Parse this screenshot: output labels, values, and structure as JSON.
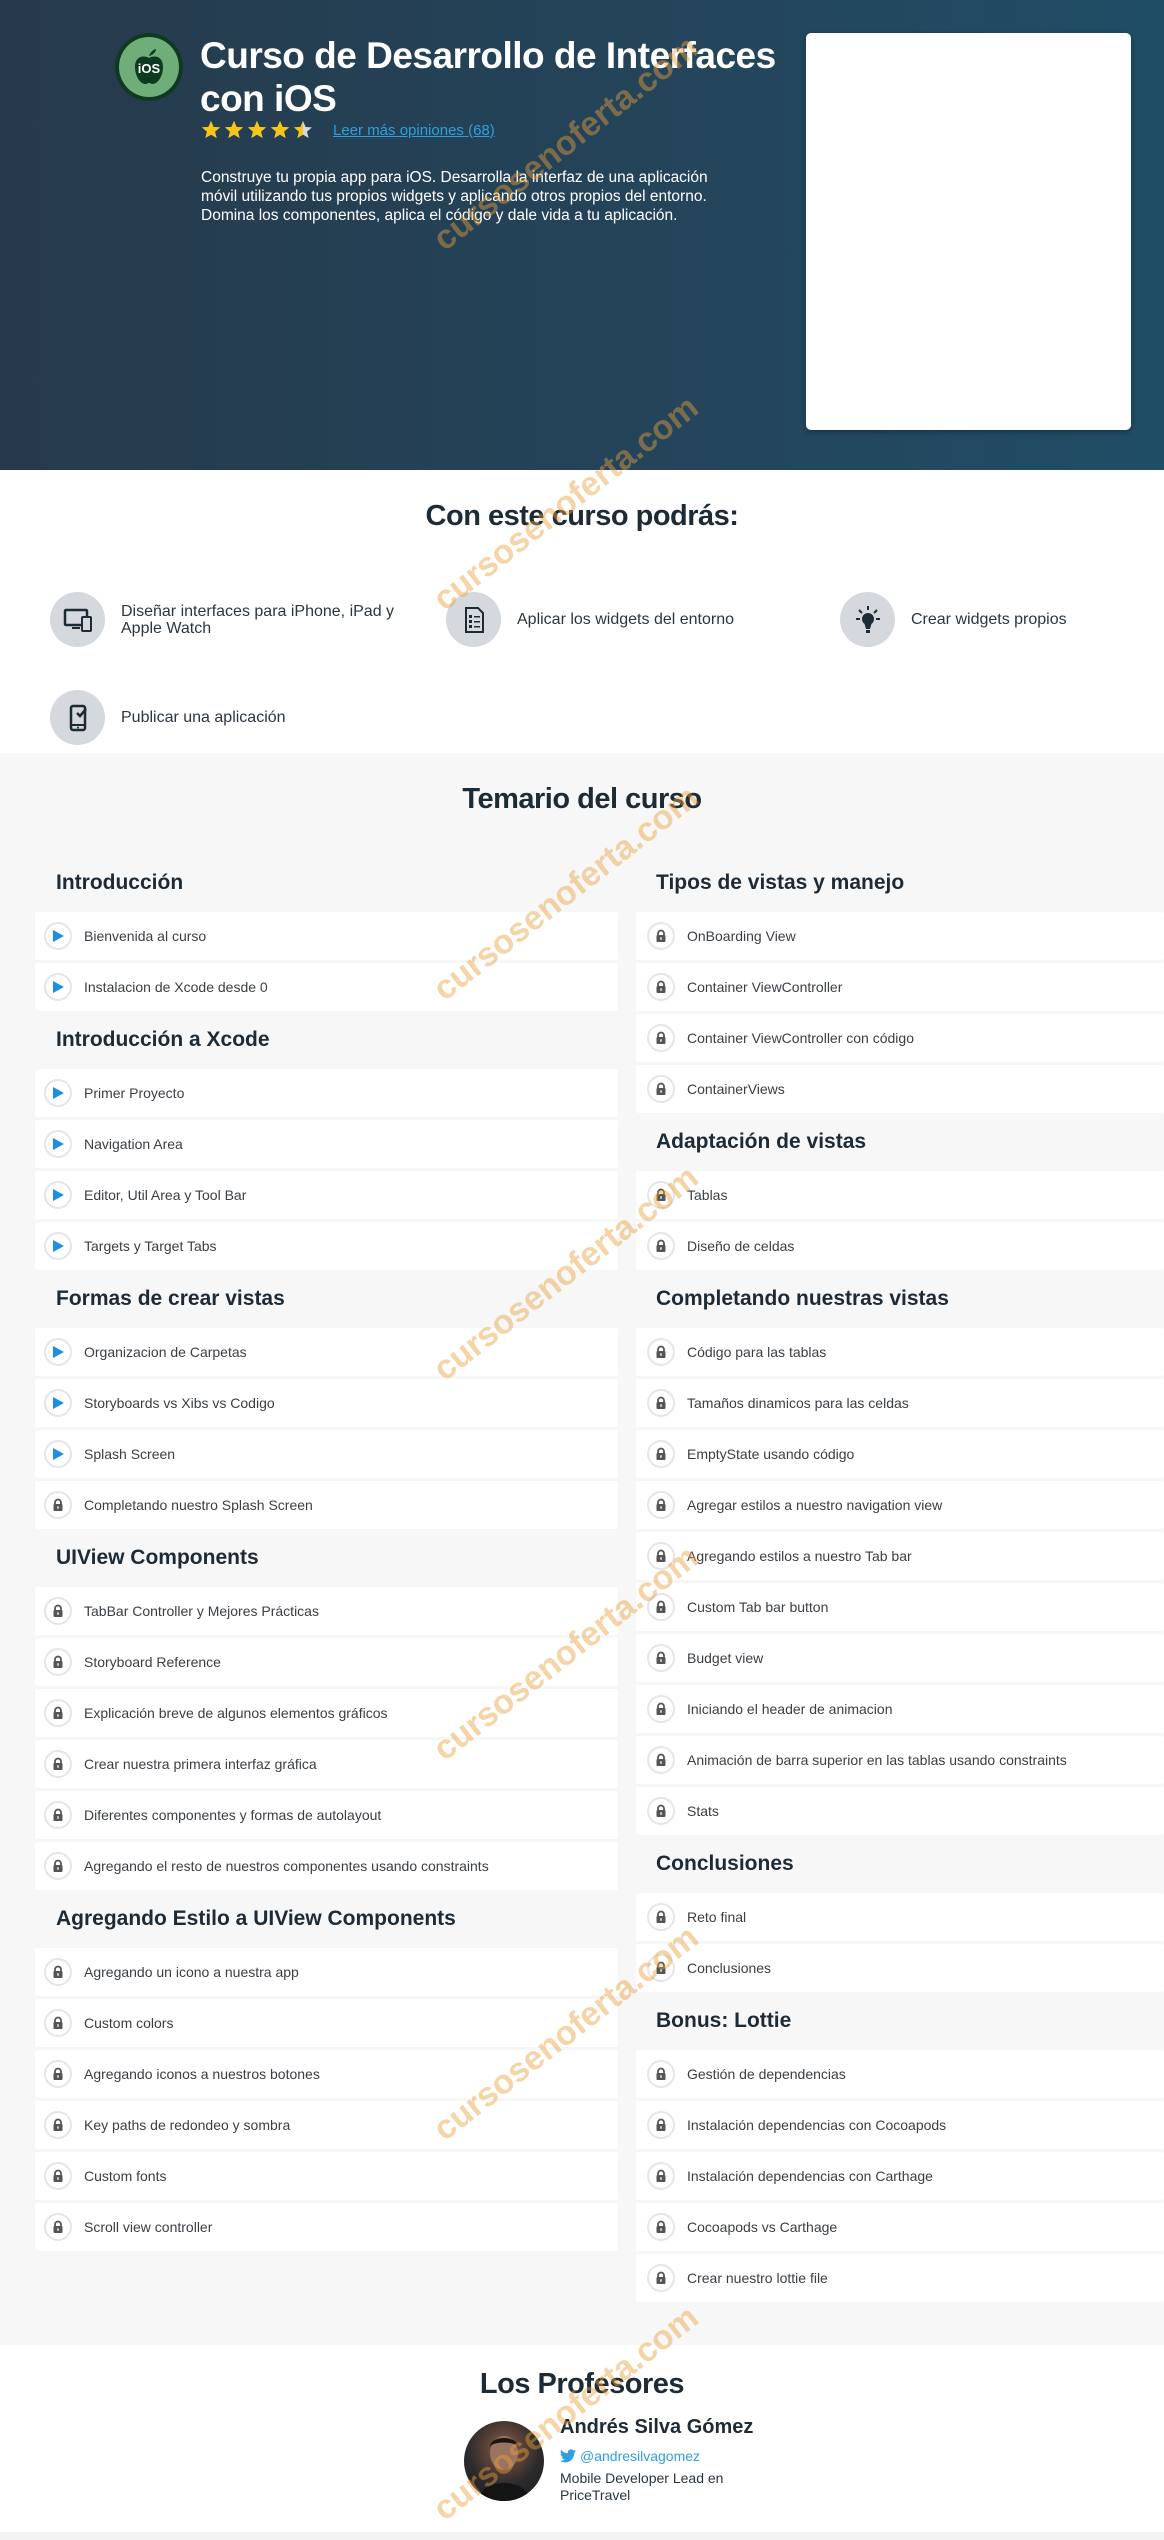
{
  "hero": {
    "logo_text": "iOS",
    "title": "Curso de Desarrollo de Interfaces con iOS",
    "rating": 4.5,
    "rating_max": 5,
    "reviews_link": "Leer más opiniones (68)",
    "description": "Construye tu propia app para iOS. Desarrolla la interfaz de una aplicación móvil utilizando tus propios widgets y aplicando otros propios del entorno. Domina los componentes, aplica el código y dale vida a tu aplicación."
  },
  "benefits": {
    "title": "Con este curso podrás:",
    "items": [
      {
        "icon": "devices-icon",
        "label": "Diseñar interfaces para iPhone, iPad y Apple Watch"
      },
      {
        "icon": "checklist-icon",
        "label": "Aplicar los widgets del entorno"
      },
      {
        "icon": "lightbulb-icon",
        "label": "Crear widgets propios"
      },
      {
        "icon": "phone-check-icon",
        "label": "Publicar una aplicación"
      }
    ]
  },
  "syllabus": {
    "title": "Temario del curso",
    "left": [
      {
        "title": "Introducción",
        "lessons": [
          {
            "label": "Bienvenida al curso",
            "status": "play"
          },
          {
            "label": "Instalacion de Xcode desde 0",
            "status": "play"
          }
        ]
      },
      {
        "title": "Introducción a Xcode",
        "lessons": [
          {
            "label": "Primer Proyecto",
            "status": "play"
          },
          {
            "label": "Navigation Area",
            "status": "play"
          },
          {
            "label": "Editor, Util Area y Tool Bar",
            "status": "play"
          },
          {
            "label": "Targets y Target Tabs",
            "status": "play"
          }
        ]
      },
      {
        "title": "Formas de crear vistas",
        "lessons": [
          {
            "label": "Organizacion de Carpetas",
            "status": "play"
          },
          {
            "label": "Storyboards vs Xibs vs Codigo",
            "status": "play"
          },
          {
            "label": "Splash Screen",
            "status": "play"
          },
          {
            "label": "Completando nuestro Splash Screen",
            "status": "locked"
          }
        ]
      },
      {
        "title": "UIView Components",
        "lessons": [
          {
            "label": "TabBar Controller y Mejores Prácticas",
            "status": "locked"
          },
          {
            "label": "Storyboard Reference",
            "status": "locked"
          },
          {
            "label": "Explicación breve de algunos elementos gráficos",
            "status": "locked"
          },
          {
            "label": "Crear nuestra primera interfaz gráfica",
            "status": "locked"
          },
          {
            "label": "Diferentes componentes y formas de autolayout",
            "status": "locked"
          },
          {
            "label": "Agregando el resto de nuestros componentes usando constraints",
            "status": "locked"
          }
        ]
      },
      {
        "title": "Agregando Estilo a UIView Components",
        "lessons": [
          {
            "label": "Agregando un icono a nuestra app",
            "status": "locked"
          },
          {
            "label": "Custom colors",
            "status": "locked"
          },
          {
            "label": "Agregando iconos a nuestros botones",
            "status": "locked"
          },
          {
            "label": "Key paths de redondeo y sombra",
            "status": "locked"
          },
          {
            "label": "Custom fonts",
            "status": "locked"
          },
          {
            "label": "Scroll view controller",
            "status": "locked"
          }
        ]
      }
    ],
    "right": [
      {
        "title": "Tipos de vistas y manejo",
        "lessons": [
          {
            "label": "OnBoarding View",
            "status": "locked"
          },
          {
            "label": "Container ViewController",
            "status": "locked"
          },
          {
            "label": "Container ViewController con código",
            "status": "locked"
          },
          {
            "label": "ContainerViews",
            "status": "locked"
          }
        ]
      },
      {
        "title": "Adaptación de vistas",
        "lessons": [
          {
            "label": "Tablas",
            "status": "locked"
          },
          {
            "label": "Diseño de celdas",
            "status": "locked"
          }
        ]
      },
      {
        "title": "Completando nuestras vistas",
        "lessons": [
          {
            "label": "Código para las tablas",
            "status": "locked"
          },
          {
            "label": "Tamaños dinamicos para las celdas",
            "status": "locked"
          },
          {
            "label": "EmptyState usando código",
            "status": "locked"
          },
          {
            "label": "Agregar estilos a nuestro navigation view",
            "status": "locked"
          },
          {
            "label": "Agregando estilos a nuestro Tab bar",
            "status": "locked"
          },
          {
            "label": "Custom Tab bar button",
            "status": "locked"
          },
          {
            "label": "Budget view",
            "status": "locked"
          },
          {
            "label": "Iniciando el header de animacion",
            "status": "locked"
          },
          {
            "label": "Animación de barra superior en las tablas usando constraints",
            "status": "locked"
          },
          {
            "label": "Stats",
            "status": "locked"
          }
        ]
      },
      {
        "title": "Conclusiones",
        "lessons": [
          {
            "label": "Reto final",
            "status": "locked"
          },
          {
            "label": "Conclusiones",
            "status": "locked"
          }
        ]
      },
      {
        "title": "Bonus: Lottie",
        "lessons": [
          {
            "label": "Gestión de dependencias",
            "status": "locked"
          },
          {
            "label": "Instalación dependencias con Cocoapods",
            "status": "locked"
          },
          {
            "label": "Instalación dependencias con Carthage",
            "status": "locked"
          },
          {
            "label": "Cocoapods vs Carthage",
            "status": "locked"
          },
          {
            "label": "Crear nuestro lottie file",
            "status": "locked"
          }
        ]
      }
    ]
  },
  "professors": {
    "title": "Los Profesores",
    "items": [
      {
        "name": "Andrés Silva Gómez",
        "twitter": "@andresilvagomez",
        "role": "Mobile Developer Lead en PriceTravel"
      }
    ]
  },
  "watermark": "cursosenoferta.com",
  "colors": {
    "hero_bg": "#24445a",
    "accent_blue": "#2f9fe0",
    "play_blue": "#1a8fe3",
    "star_gold": "#f5c518",
    "heading": "#1d2b36",
    "syllabus_bg": "#f7f7f7",
    "logo_green": "#6fae78"
  }
}
